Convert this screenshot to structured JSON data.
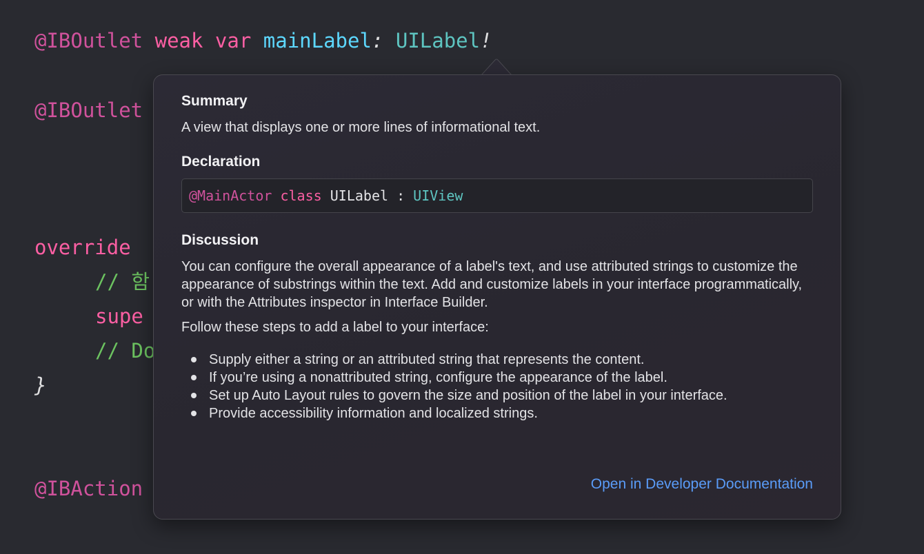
{
  "code": {
    "line1": {
      "attr": "@IBOutlet",
      "kw1": "weak",
      "kw2": "var",
      "name": "mainLabel",
      "colon": ":",
      "type": "UILabel",
      "bang": "!"
    },
    "line2": {
      "attr": "@IBOutlet"
    },
    "line3": {
      "kw": "override"
    },
    "line4": {
      "comment": "// 함"
    },
    "line5": {
      "text": "supe"
    },
    "line6": {
      "comment": "// Do"
    },
    "line7": {
      "brace": "}"
    },
    "line8": {
      "attr": "@IBAction"
    }
  },
  "popover": {
    "summary_title": "Summary",
    "summary_text": "A view that displays one or more lines of informational text.",
    "declaration_title": "Declaration",
    "declaration": {
      "attr": "@MainActor",
      "kw": "class",
      "name": "UILabel",
      "sep": ":",
      "super": "UIView"
    },
    "discussion_title": "Discussion",
    "discussion_p1": "You can configure the overall appearance of a label's text, and use attributed strings to customize the appearance of substrings within the text. Add and customize labels in your interface programmatically, or with the Attributes inspector in Interface Builder.",
    "discussion_p2": "Follow these steps to add a label to your interface:",
    "bullets": [
      "Supply either a string or an attributed string that represents the content.",
      "If you’re using a nonattributed string, configure the appearance of the label.",
      "Set up Auto Layout rules to govern the size and position of the label in your interface.",
      "Provide accessibility information and localized strings."
    ],
    "link": "Open in Developer Documentation"
  },
  "colors": {
    "background": "#292a30",
    "keyword": "#fc5fa3",
    "type": "#5ec5c1",
    "identifier": "#5dd8ff",
    "comment": "#6cc360",
    "link": "#5a9cf8"
  }
}
